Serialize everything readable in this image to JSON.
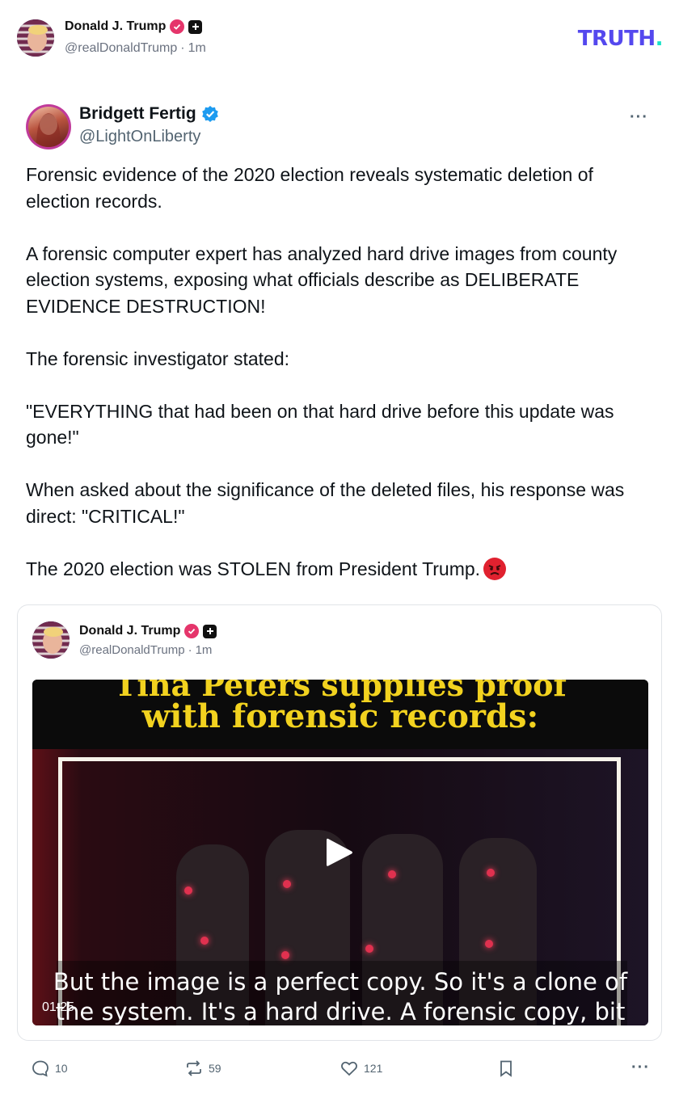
{
  "header": {
    "author_name": "Donald J. Trump",
    "author_handle": "@realDonaldTrump",
    "separator": "·",
    "time_ago": "1m",
    "logo_text": "TRUTH",
    "logo_dot": "."
  },
  "post": {
    "author_name": "Bridgett Fertig",
    "author_handle": "@LightOnLiberty",
    "more_label": "···",
    "paragraphs": [
      "Forensic evidence of the 2020 election reveals systematic deletion of election records.",
      "A forensic computer expert has analyzed hard drive images from county election systems, exposing what officials describe as DELIBERATE EVIDENCE DESTRUCTION!",
      "The forensic investigator stated:",
      "\"EVERYTHING that had been on that hard drive before this update was gone!\"",
      "When asked about the significance of the deleted files, his response was direct: \"CRITICAL!\"",
      "The 2020 election was STOLEN from President Trump."
    ],
    "emoji": "angry-face-icon"
  },
  "quote": {
    "author_name": "Donald J. Trump",
    "author_handle": "@realDonaldTrump",
    "separator": "·",
    "time_ago": "1m",
    "video": {
      "headline_partial": "Tina Peters supplies proof",
      "headline": "with forensic records:",
      "caption_line1": "But the image is a perfect copy. So it's a clone of",
      "caption_line2": "the system. It's a hard drive. A forensic copy, bit",
      "duration": "01:25"
    }
  },
  "actions": {
    "replies": "10",
    "retruths": "59",
    "likes": "121",
    "more_label": "···"
  },
  "colors": {
    "brand": "#5448ee",
    "brand_dot": "#17e3c8",
    "verified_red": "#e5356b",
    "verified_blue": "#1d9bf0",
    "video_headline": "#f2d21f"
  }
}
